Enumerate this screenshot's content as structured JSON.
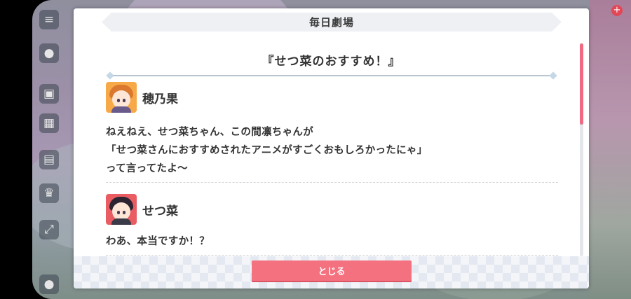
{
  "dialog": {
    "header_title": "毎日劇場",
    "story_title": "『せつ菜のおすすめ！』",
    "close_label": "とじる"
  },
  "entries": [
    {
      "speaker": "穂乃果",
      "lines": [
        "ねえねえ、せつ菜ちゃん、この間凛ちゃんが",
        "「せつ菜さんにおすすめされたアニメがすごくおもしろかったにゃ」",
        "って言ってたよ〜"
      ]
    },
    {
      "speaker": "せつ菜",
      "lines": [
        "わあ、本当ですか！？"
      ]
    }
  ],
  "background": {
    "side_icons": [
      "menu-icon",
      "chat-icon",
      "present-icon",
      "gift-icon",
      "photo-icon",
      "trophy-icon",
      "expand-icon",
      "profile-icon"
    ]
  },
  "colors": {
    "accent_pink": "#f4717f",
    "scroll_thumb": "#f06b82",
    "honoka_avatar": "#f7a948",
    "setsuna_avatar": "#e85c62"
  }
}
